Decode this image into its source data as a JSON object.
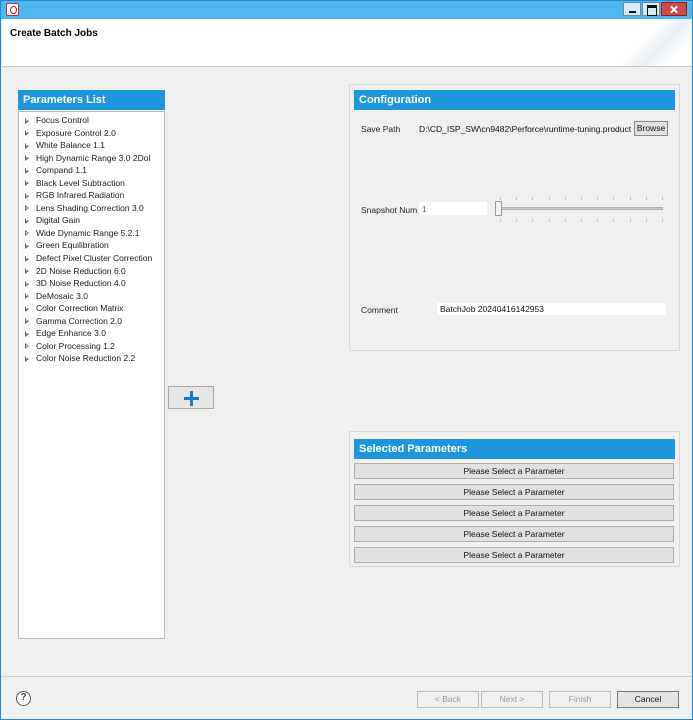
{
  "window": {
    "title": "",
    "header_title": "Create Batch Jobs"
  },
  "parameters": {
    "heading": "Parameters List",
    "items": [
      "Focus Control",
      "Exposure Control 2.0",
      "White Balance 1.1",
      "High Dynamic Range 3.0 2DoI",
      "Compand 1.1",
      "Black Level Subtraction",
      "RGB Infrared Radiation",
      "Lens Shading Correction 3.0",
      "Digital Gain",
      "Wide Dynamic Range 5.2.1",
      "Green Equilibration",
      "Defect Pixel Cluster Correction",
      "2D Noise Reduction 6.0",
      "3D Noise Reduction 4.0",
      "DeMosaic 3.0",
      "Color Correction Matrix",
      "Gamma Correction 2.0",
      "Edge Enhance 3.0",
      "Color Processing 1.2",
      "Color Noise Reduction 2.2"
    ],
    "add_icon": "plus-icon"
  },
  "configuration": {
    "heading": "Configuration",
    "save_path_label": "Save Path",
    "save_path_value": "D:\\CD_ISP_SW\\cn9482\\Perforce\\runtime-tuning.product",
    "browse_label": "Browse",
    "snapshot_label": "Snapshot Num",
    "snapshot_value": "1",
    "comment_label": "Comment",
    "comment_value": "BatchJob 20240416142953"
  },
  "selected": {
    "heading": "Selected Parameters",
    "slots": [
      "Please Select a Parameter",
      "Please Select a Parameter",
      "Please Select a Parameter",
      "Please Select a Parameter",
      "Please Select a Parameter"
    ]
  },
  "footer": {
    "help_icon": "help-icon",
    "help_glyph": "?",
    "back_label": "< Back",
    "next_label": "Next >",
    "finish_label": "Finish",
    "cancel_label": "Cancel"
  },
  "colors": {
    "accent": "#1e96dc",
    "titlebar": "#4db8f0"
  }
}
